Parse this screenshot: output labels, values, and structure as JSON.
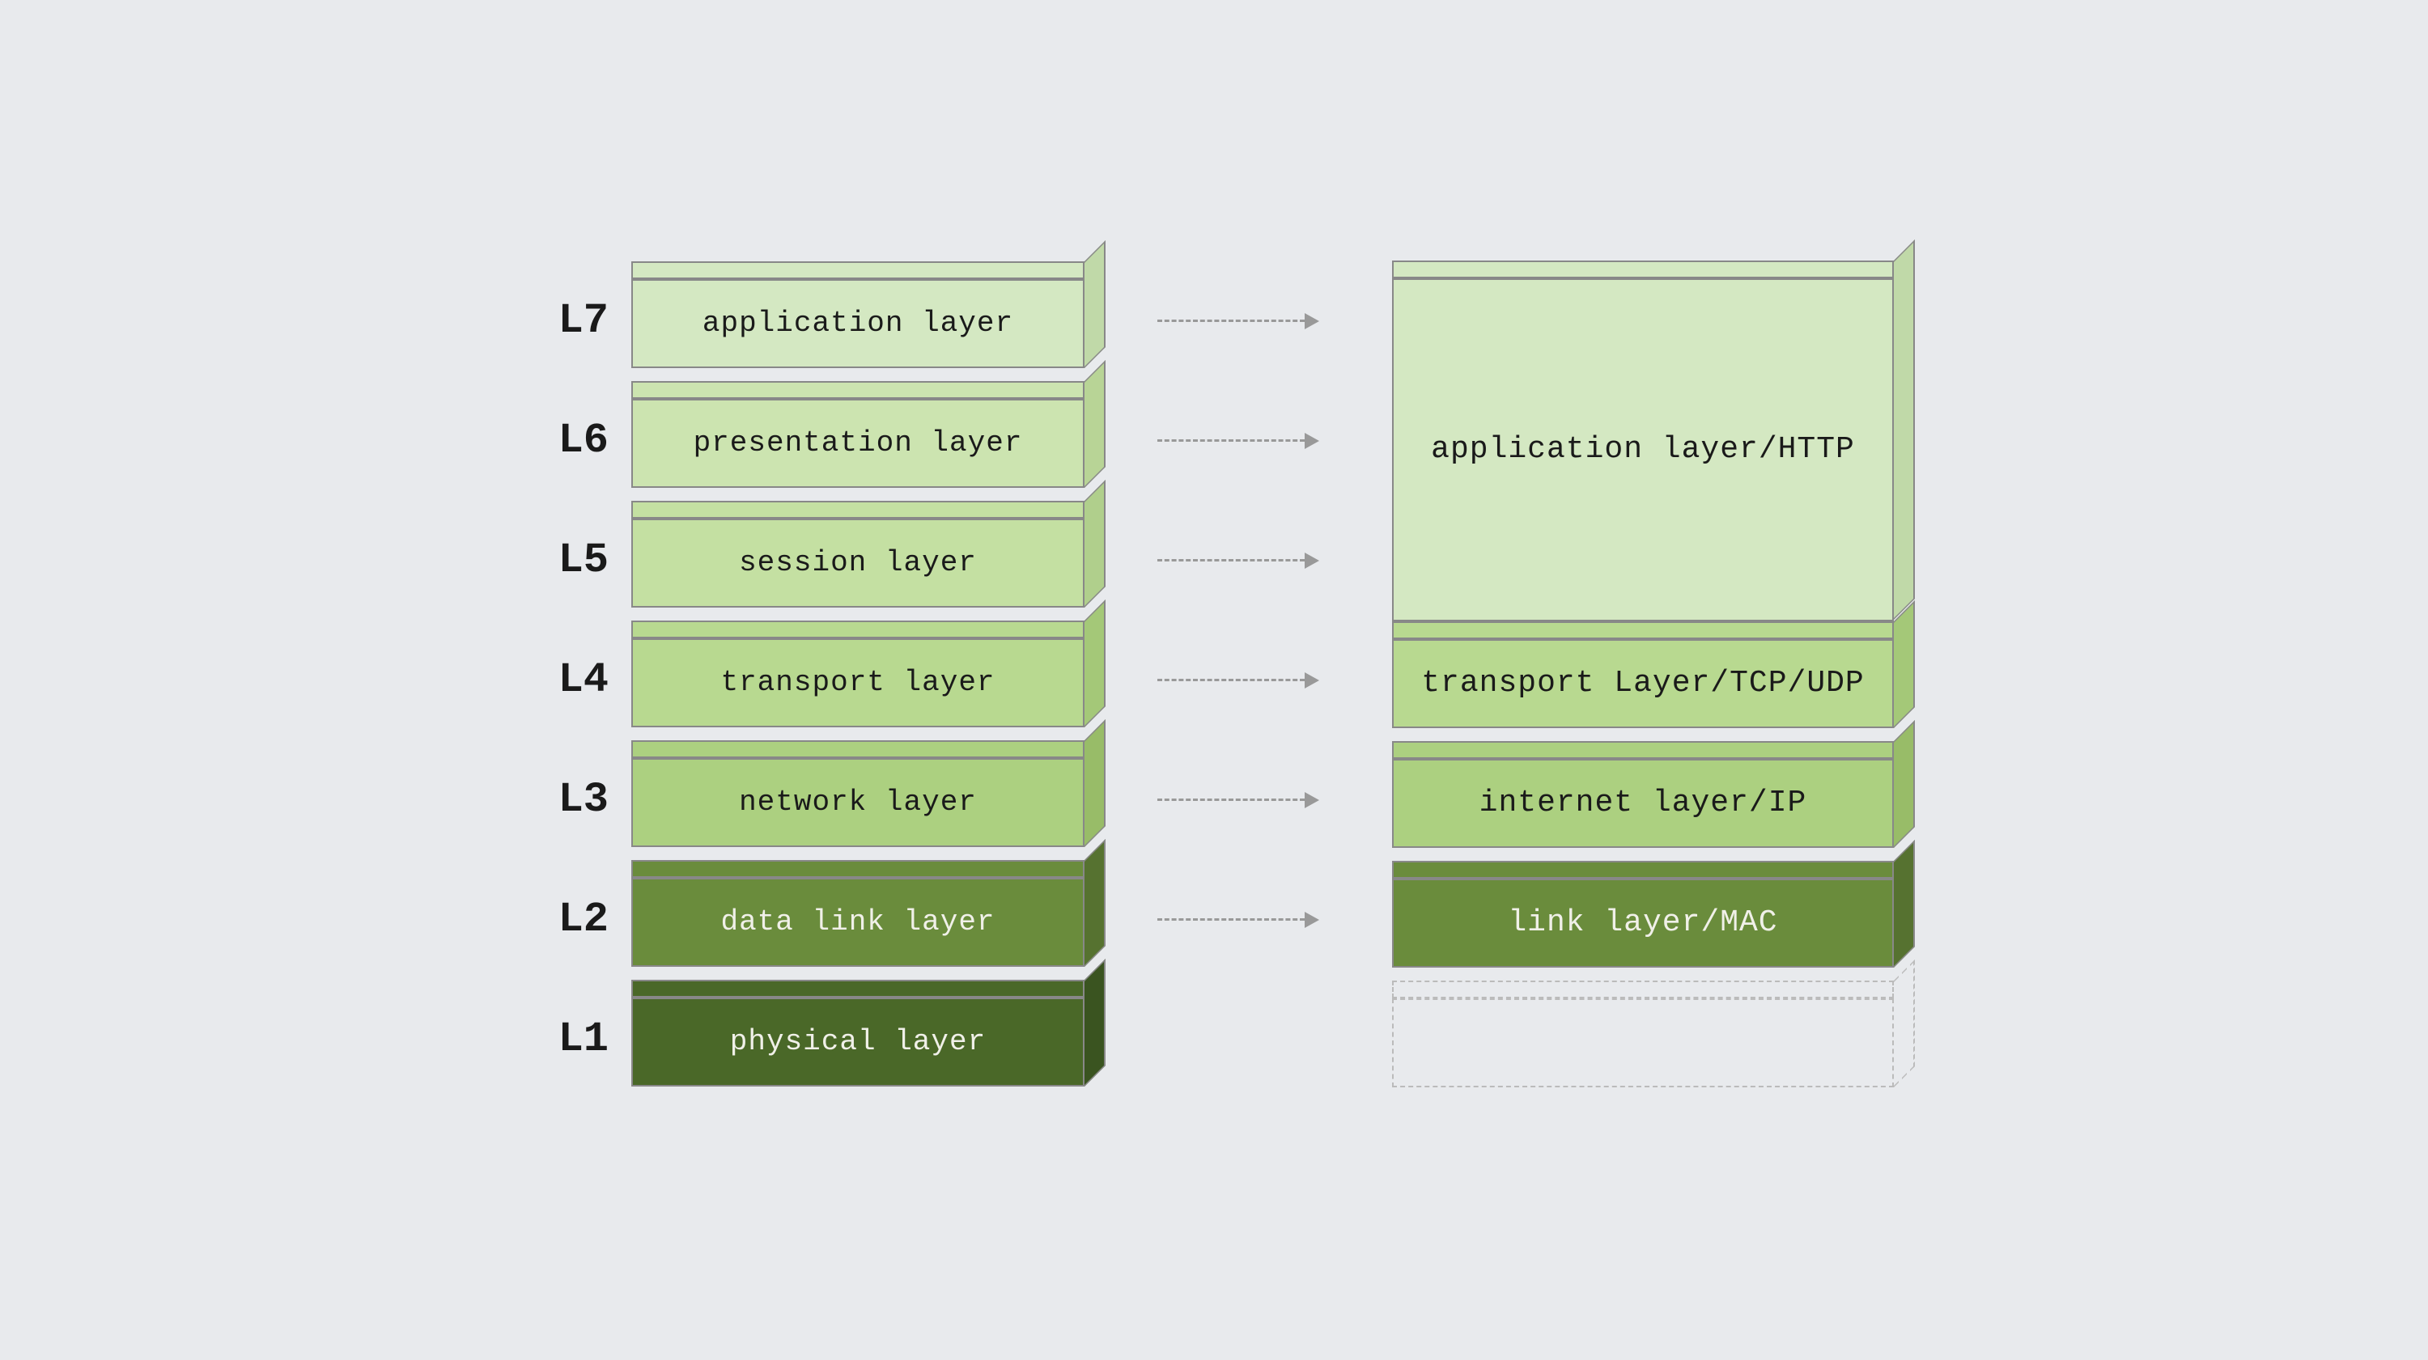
{
  "background": "#e8eaed",
  "left_stack": {
    "layers": [
      {
        "label": "L7",
        "text": "application layer",
        "color": "l7"
      },
      {
        "label": "L6",
        "text": "presentation layer",
        "color": "l6"
      },
      {
        "label": "L5",
        "text": "session layer",
        "color": "l5"
      },
      {
        "label": "L4",
        "text": "transport layer",
        "color": "l4"
      },
      {
        "label": "L3",
        "text": "network layer",
        "color": "l3"
      },
      {
        "label": "L2",
        "text": "data link layer",
        "color": "l2"
      },
      {
        "label": "L1",
        "text": "physical layer",
        "color": "l1"
      }
    ]
  },
  "right_stack": {
    "blocks": [
      {
        "id": "app",
        "text": "application layer/HTTP",
        "color": "app",
        "spans": 3
      },
      {
        "id": "transport",
        "text": "transport Layer/TCP/UDP",
        "color": "transport",
        "spans": 1
      },
      {
        "id": "internet",
        "text": "internet layer/IP",
        "color": "internet",
        "spans": 1
      },
      {
        "id": "link",
        "text": "link layer/MAC",
        "color": "link",
        "spans": 1
      },
      {
        "id": "physical",
        "text": "",
        "color": "physical",
        "spans": 1
      }
    ]
  }
}
